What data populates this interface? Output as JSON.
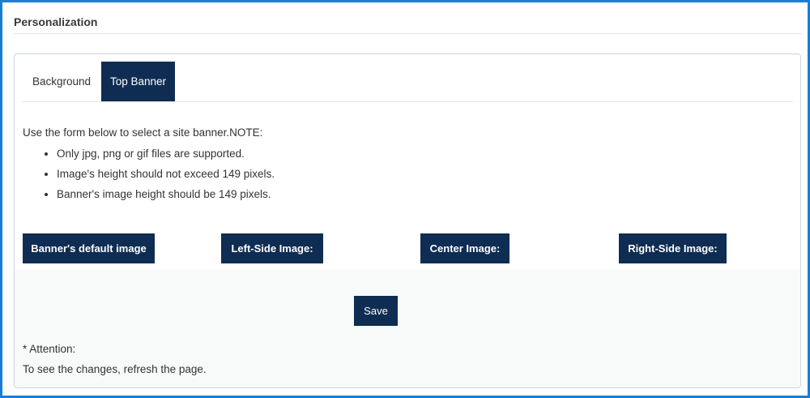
{
  "page": {
    "title": "Personalization"
  },
  "tabs": [
    {
      "label": "Background",
      "active": false
    },
    {
      "label": "Top Banner",
      "active": true
    }
  ],
  "content": {
    "intro": "Use the form below to select a site banner.NOTE:",
    "notes": [
      "Only jpg, png or gif files are supported.",
      "Image's height should not exceed 149 pixels.",
      "Banner's image height should be 149 pixels."
    ]
  },
  "buttons": {
    "default_image": "Banner's default image",
    "left_image": "Left-Side Image:",
    "center_image": "Center Image:",
    "right_image": "Right-Side Image:",
    "save": "Save"
  },
  "footer": {
    "attention": "* Attention:",
    "refresh_note": "To see the changes, refresh the page."
  },
  "colors": {
    "accent": "#0f2d53",
    "frame_border": "#1a7fd4"
  }
}
